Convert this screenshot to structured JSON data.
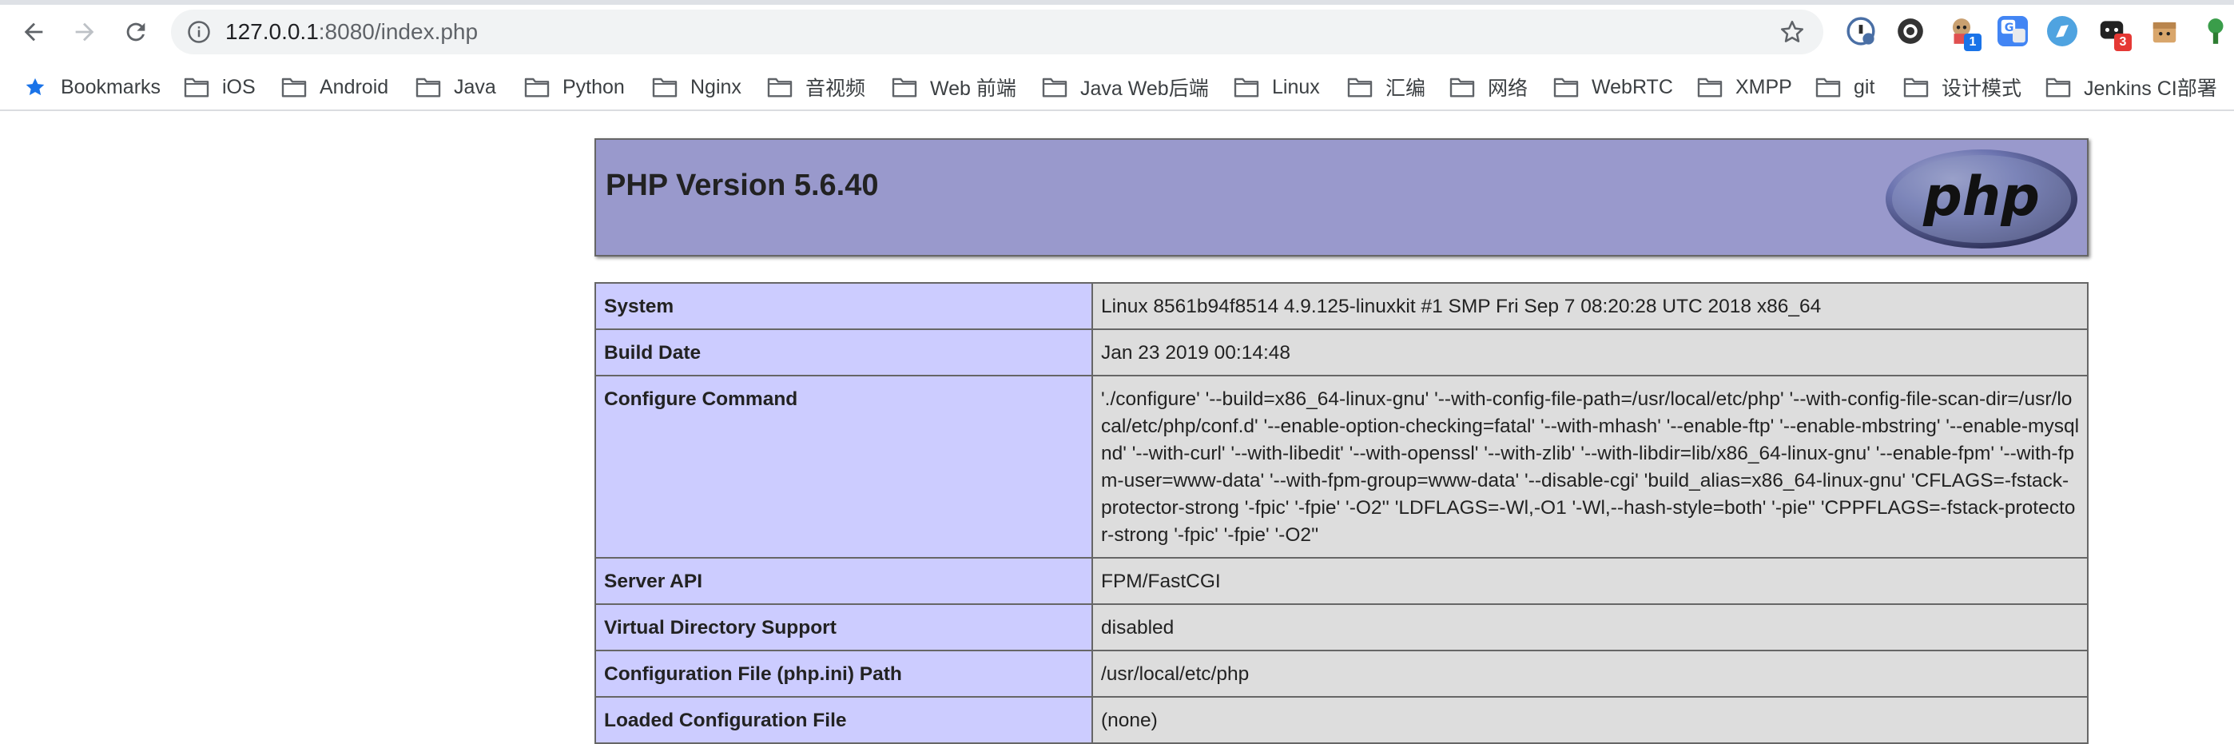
{
  "browser": {
    "url_host": "127.0.0.1",
    "url_rest": ":8080/index.php",
    "extension_badges": {
      "ext2": "1",
      "ext6": "3"
    }
  },
  "bookmarks": [
    {
      "label": "Bookmarks",
      "icon": "star-icon"
    },
    {
      "label": "iOS",
      "icon": "folder-icon"
    },
    {
      "label": "Android",
      "icon": "folder-icon"
    },
    {
      "label": "Java",
      "icon": "folder-icon"
    },
    {
      "label": "Python",
      "icon": "folder-icon"
    },
    {
      "label": "Nginx",
      "icon": "folder-icon"
    },
    {
      "label": "音视频",
      "icon": "folder-icon"
    },
    {
      "label": "Web 前端",
      "icon": "folder-icon"
    },
    {
      "label": "Java Web后端",
      "icon": "folder-icon"
    },
    {
      "label": "Linux",
      "icon": "folder-icon"
    },
    {
      "label": "汇编",
      "icon": "folder-icon"
    },
    {
      "label": "网络",
      "icon": "folder-icon"
    },
    {
      "label": "WebRTC",
      "icon": "folder-icon"
    },
    {
      "label": "XMPP",
      "icon": "folder-icon"
    },
    {
      "label": "git",
      "icon": "folder-icon"
    },
    {
      "label": "设计模式",
      "icon": "folder-icon"
    },
    {
      "label": "Jenkins CI部署",
      "icon": "folder-icon"
    }
  ],
  "phpinfo": {
    "title": "PHP Version 5.6.40",
    "logo_text": "php",
    "colors": {
      "header_bg": "#9999cc",
      "key_bg": "#ccccff",
      "value_bg": "#dddddd",
      "border": "#666666"
    },
    "rows": [
      {
        "key": "System",
        "value": "Linux 8561b94f8514 4.9.125-linuxkit #1 SMP Fri Sep 7 08:20:28 UTC 2018 x86_64"
      },
      {
        "key": "Build Date",
        "value": "Jan 23 2019 00:14:48"
      },
      {
        "key": "Configure Command",
        "value": "'./configure' '--build=x86_64-linux-gnu' '--with-config-file-path=/usr/local/etc/php' '--with-config-file-scan-dir=/usr/local/etc/php/conf.d' '--enable-option-checking=fatal' '--with-mhash' '--enable-ftp' '--enable-mbstring' '--enable-mysqlnd' '--with-curl' '--with-libedit' '--with-openssl' '--with-zlib' '--with-libdir=lib/x86_64-linux-gnu' '--enable-fpm' '--with-fpm-user=www-data' '--with-fpm-group=www-data' '--disable-cgi' 'build_alias=x86_64-linux-gnu' 'CFLAGS=-fstack-protector-strong '-fpic' '-fpie' '-O2'' 'LDFLAGS=-Wl,-O1 '-Wl,--hash-style=both' '-pie'' 'CPPFLAGS=-fstack-protector-strong '-fpic' '-fpie' '-O2''"
      },
      {
        "key": "Server API",
        "value": "FPM/FastCGI"
      },
      {
        "key": "Virtual Directory Support",
        "value": "disabled"
      },
      {
        "key": "Configuration File (php.ini) Path",
        "value": "/usr/local/etc/php"
      },
      {
        "key": "Loaded Configuration File",
        "value": "(none)"
      }
    ]
  }
}
